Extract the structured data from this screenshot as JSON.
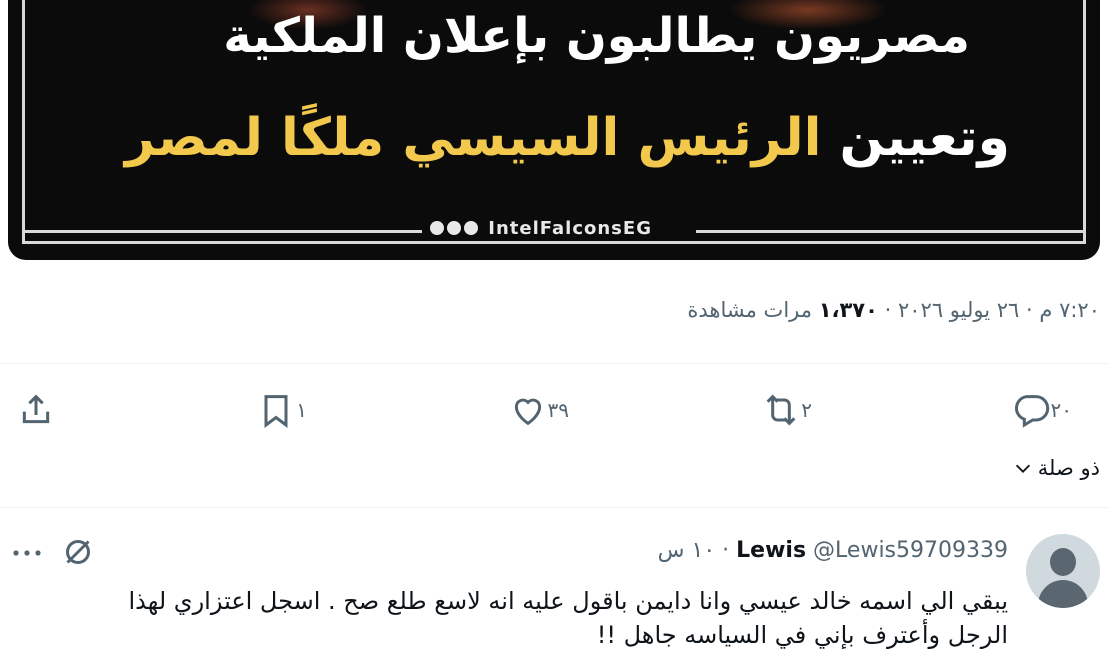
{
  "media": {
    "headline_line1": "مصريون يطالبون بإعلان الملكية",
    "headline_line2_white": "وتعيين",
    "headline_line2_yellow": "الرئيس السيسي ملكًا لمصر",
    "brand_handle": "IntelFalconsEG",
    "colors": {
      "background": "#0b0b0b",
      "white_text": "#ffffff",
      "yellow_text": "#f2c94c"
    }
  },
  "tweet_meta": {
    "time": "٧:٢٠ م",
    "date": "٢٦ يوليو ٢٠٢٦",
    "views_count": "١،٣٧٠",
    "views_label": "مرات مشاهدة",
    "separator": "·"
  },
  "actions": {
    "replies": {
      "icon": "reply-icon",
      "count": "٢٠"
    },
    "retweets": {
      "icon": "retweet-icon",
      "count": "٢"
    },
    "likes": {
      "icon": "like-icon",
      "count": "٣٩"
    },
    "bookmarks": {
      "icon": "bookmark-icon",
      "count": "١"
    },
    "share": {
      "icon": "share-icon"
    }
  },
  "related": {
    "label": "ذو صلة",
    "icon": "chevron-down-icon"
  },
  "reply": {
    "name": "Lewis",
    "handle": "@Lewis59709339",
    "time": "١٠ س",
    "separator": "·",
    "text": "يبقي الي اسمه خالد عيسي وانا دايمن باقول عليه انه لاسع طلع صح . اسجل اعتزاري لهذا الرجل وأعترف بإني في السياسه جاهل !!"
  },
  "colors": {
    "muted": "#536471",
    "text": "#0f1419",
    "divider": "#eff3f4"
  }
}
